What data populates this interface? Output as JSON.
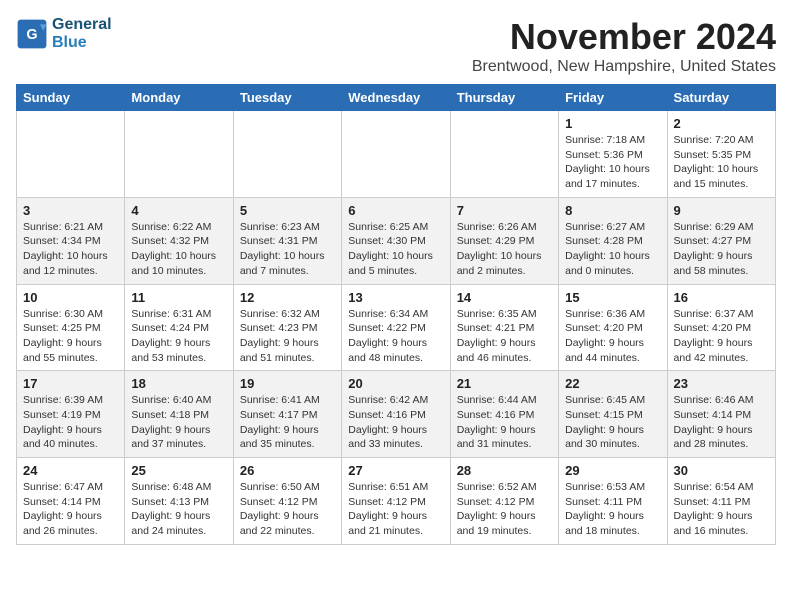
{
  "header": {
    "logo_line1": "General",
    "logo_line2": "Blue",
    "month": "November 2024",
    "location": "Brentwood, New Hampshire, United States"
  },
  "days_of_week": [
    "Sunday",
    "Monday",
    "Tuesday",
    "Wednesday",
    "Thursday",
    "Friday",
    "Saturday"
  ],
  "weeks": [
    [
      {
        "day": "",
        "info": ""
      },
      {
        "day": "",
        "info": ""
      },
      {
        "day": "",
        "info": ""
      },
      {
        "day": "",
        "info": ""
      },
      {
        "day": "",
        "info": ""
      },
      {
        "day": "1",
        "info": "Sunrise: 7:18 AM\nSunset: 5:36 PM\nDaylight: 10 hours and 17 minutes."
      },
      {
        "day": "2",
        "info": "Sunrise: 7:20 AM\nSunset: 5:35 PM\nDaylight: 10 hours and 15 minutes."
      }
    ],
    [
      {
        "day": "3",
        "info": "Sunrise: 6:21 AM\nSunset: 4:34 PM\nDaylight: 10 hours and 12 minutes."
      },
      {
        "day": "4",
        "info": "Sunrise: 6:22 AM\nSunset: 4:32 PM\nDaylight: 10 hours and 10 minutes."
      },
      {
        "day": "5",
        "info": "Sunrise: 6:23 AM\nSunset: 4:31 PM\nDaylight: 10 hours and 7 minutes."
      },
      {
        "day": "6",
        "info": "Sunrise: 6:25 AM\nSunset: 4:30 PM\nDaylight: 10 hours and 5 minutes."
      },
      {
        "day": "7",
        "info": "Sunrise: 6:26 AM\nSunset: 4:29 PM\nDaylight: 10 hours and 2 minutes."
      },
      {
        "day": "8",
        "info": "Sunrise: 6:27 AM\nSunset: 4:28 PM\nDaylight: 10 hours and 0 minutes."
      },
      {
        "day": "9",
        "info": "Sunrise: 6:29 AM\nSunset: 4:27 PM\nDaylight: 9 hours and 58 minutes."
      }
    ],
    [
      {
        "day": "10",
        "info": "Sunrise: 6:30 AM\nSunset: 4:25 PM\nDaylight: 9 hours and 55 minutes."
      },
      {
        "day": "11",
        "info": "Sunrise: 6:31 AM\nSunset: 4:24 PM\nDaylight: 9 hours and 53 minutes."
      },
      {
        "day": "12",
        "info": "Sunrise: 6:32 AM\nSunset: 4:23 PM\nDaylight: 9 hours and 51 minutes."
      },
      {
        "day": "13",
        "info": "Sunrise: 6:34 AM\nSunset: 4:22 PM\nDaylight: 9 hours and 48 minutes."
      },
      {
        "day": "14",
        "info": "Sunrise: 6:35 AM\nSunset: 4:21 PM\nDaylight: 9 hours and 46 minutes."
      },
      {
        "day": "15",
        "info": "Sunrise: 6:36 AM\nSunset: 4:20 PM\nDaylight: 9 hours and 44 minutes."
      },
      {
        "day": "16",
        "info": "Sunrise: 6:37 AM\nSunset: 4:20 PM\nDaylight: 9 hours and 42 minutes."
      }
    ],
    [
      {
        "day": "17",
        "info": "Sunrise: 6:39 AM\nSunset: 4:19 PM\nDaylight: 9 hours and 40 minutes."
      },
      {
        "day": "18",
        "info": "Sunrise: 6:40 AM\nSunset: 4:18 PM\nDaylight: 9 hours and 37 minutes."
      },
      {
        "day": "19",
        "info": "Sunrise: 6:41 AM\nSunset: 4:17 PM\nDaylight: 9 hours and 35 minutes."
      },
      {
        "day": "20",
        "info": "Sunrise: 6:42 AM\nSunset: 4:16 PM\nDaylight: 9 hours and 33 minutes."
      },
      {
        "day": "21",
        "info": "Sunrise: 6:44 AM\nSunset: 4:16 PM\nDaylight: 9 hours and 31 minutes."
      },
      {
        "day": "22",
        "info": "Sunrise: 6:45 AM\nSunset: 4:15 PM\nDaylight: 9 hours and 30 minutes."
      },
      {
        "day": "23",
        "info": "Sunrise: 6:46 AM\nSunset: 4:14 PM\nDaylight: 9 hours and 28 minutes."
      }
    ],
    [
      {
        "day": "24",
        "info": "Sunrise: 6:47 AM\nSunset: 4:14 PM\nDaylight: 9 hours and 26 minutes."
      },
      {
        "day": "25",
        "info": "Sunrise: 6:48 AM\nSunset: 4:13 PM\nDaylight: 9 hours and 24 minutes."
      },
      {
        "day": "26",
        "info": "Sunrise: 6:50 AM\nSunset: 4:12 PM\nDaylight: 9 hours and 22 minutes."
      },
      {
        "day": "27",
        "info": "Sunrise: 6:51 AM\nSunset: 4:12 PM\nDaylight: 9 hours and 21 minutes."
      },
      {
        "day": "28",
        "info": "Sunrise: 6:52 AM\nSunset: 4:12 PM\nDaylight: 9 hours and 19 minutes."
      },
      {
        "day": "29",
        "info": "Sunrise: 6:53 AM\nSunset: 4:11 PM\nDaylight: 9 hours and 18 minutes."
      },
      {
        "day": "30",
        "info": "Sunrise: 6:54 AM\nSunset: 4:11 PM\nDaylight: 9 hours and 16 minutes."
      }
    ]
  ]
}
